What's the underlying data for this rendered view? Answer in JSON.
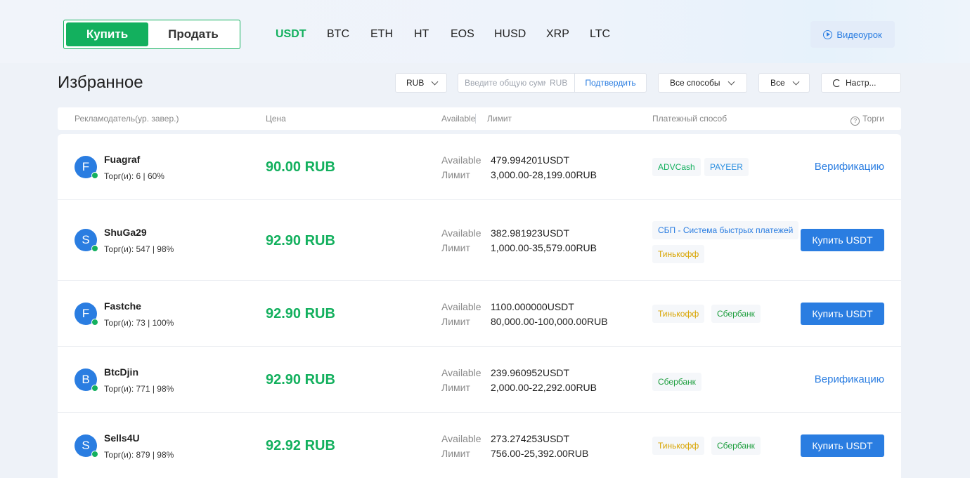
{
  "header": {
    "buy_label": "Купить",
    "sell_label": "Продать",
    "coins": [
      "USDT",
      "BTC",
      "ETH",
      "HT",
      "EOS",
      "HUSD",
      "XRP",
      "LTC"
    ],
    "active_coin": "USDT",
    "video_label": "Видеоурок"
  },
  "page_title": "Избранное",
  "filters": {
    "currency": "RUB",
    "amount_placeholder": "Введите общую сумму",
    "amount_unit": "RUB",
    "confirm_label": "Подтвердить",
    "method": "Все способы",
    "region": "Все",
    "settings_label": "Настр..."
  },
  "table": {
    "columns": {
      "advertiser": "Рекламодатель(ур. завер.)",
      "price": "Цена",
      "available": "Available",
      "limit": "Лимит",
      "payment": "Платежный способ",
      "trade": "Торги"
    },
    "available_label": "Available",
    "limit_label": "Лимит",
    "rows": [
      {
        "avatar": "F",
        "name": "Fuagraf",
        "stats": "Торг(и): 6 | 60%",
        "price": "90.00 RUB",
        "available": "479.994201USDT",
        "limit": "3,000.00-28,199.00RUB",
        "payments": [
          "ADVCash",
          "PAYEER"
        ],
        "action": "Верификацию"
      },
      {
        "avatar": "S",
        "name": "ShuGa29",
        "stats": "Торг(и): 547 | 98%",
        "price": "92.90 RUB",
        "available": "382.981923USDT",
        "limit": "1,000.00-35,579.00RUB",
        "payments": [
          "СБП - Система быстрых платежей",
          "Тинькофф"
        ],
        "action": "Купить USDT"
      },
      {
        "avatar": "F",
        "name": "Fastche",
        "stats": "Торг(и): 73 | 100%",
        "price": "92.90 RUB",
        "available": "1100.000000USDT",
        "limit": "80,000.00-100,000.00RUB",
        "payments": [
          "Тинькофф",
          "Сбербанк"
        ],
        "action": "Купить USDT"
      },
      {
        "avatar": "B",
        "name": "BtcDjin",
        "stats": "Торг(и): 771 | 98%",
        "price": "92.90 RUB",
        "available": "239.960952USDT",
        "limit": "2,000.00-22,292.00RUB",
        "payments": [
          "Сбербанк"
        ],
        "action": "Верификацию"
      },
      {
        "avatar": "S",
        "name": "Sells4U",
        "stats": "Торг(и): 879 | 98%",
        "price": "92.92 RUB",
        "available": "273.274253USDT",
        "limit": "756.00-25,392.00RUB",
        "payments": [
          "Тинькофф",
          "Сбербанк"
        ],
        "action": "Купить USDT"
      }
    ]
  },
  "colors": {
    "green": "#13b05e",
    "blue": "#2a7de1",
    "tinkoff": "#d8a400",
    "sber": "#1e9e3e"
  }
}
